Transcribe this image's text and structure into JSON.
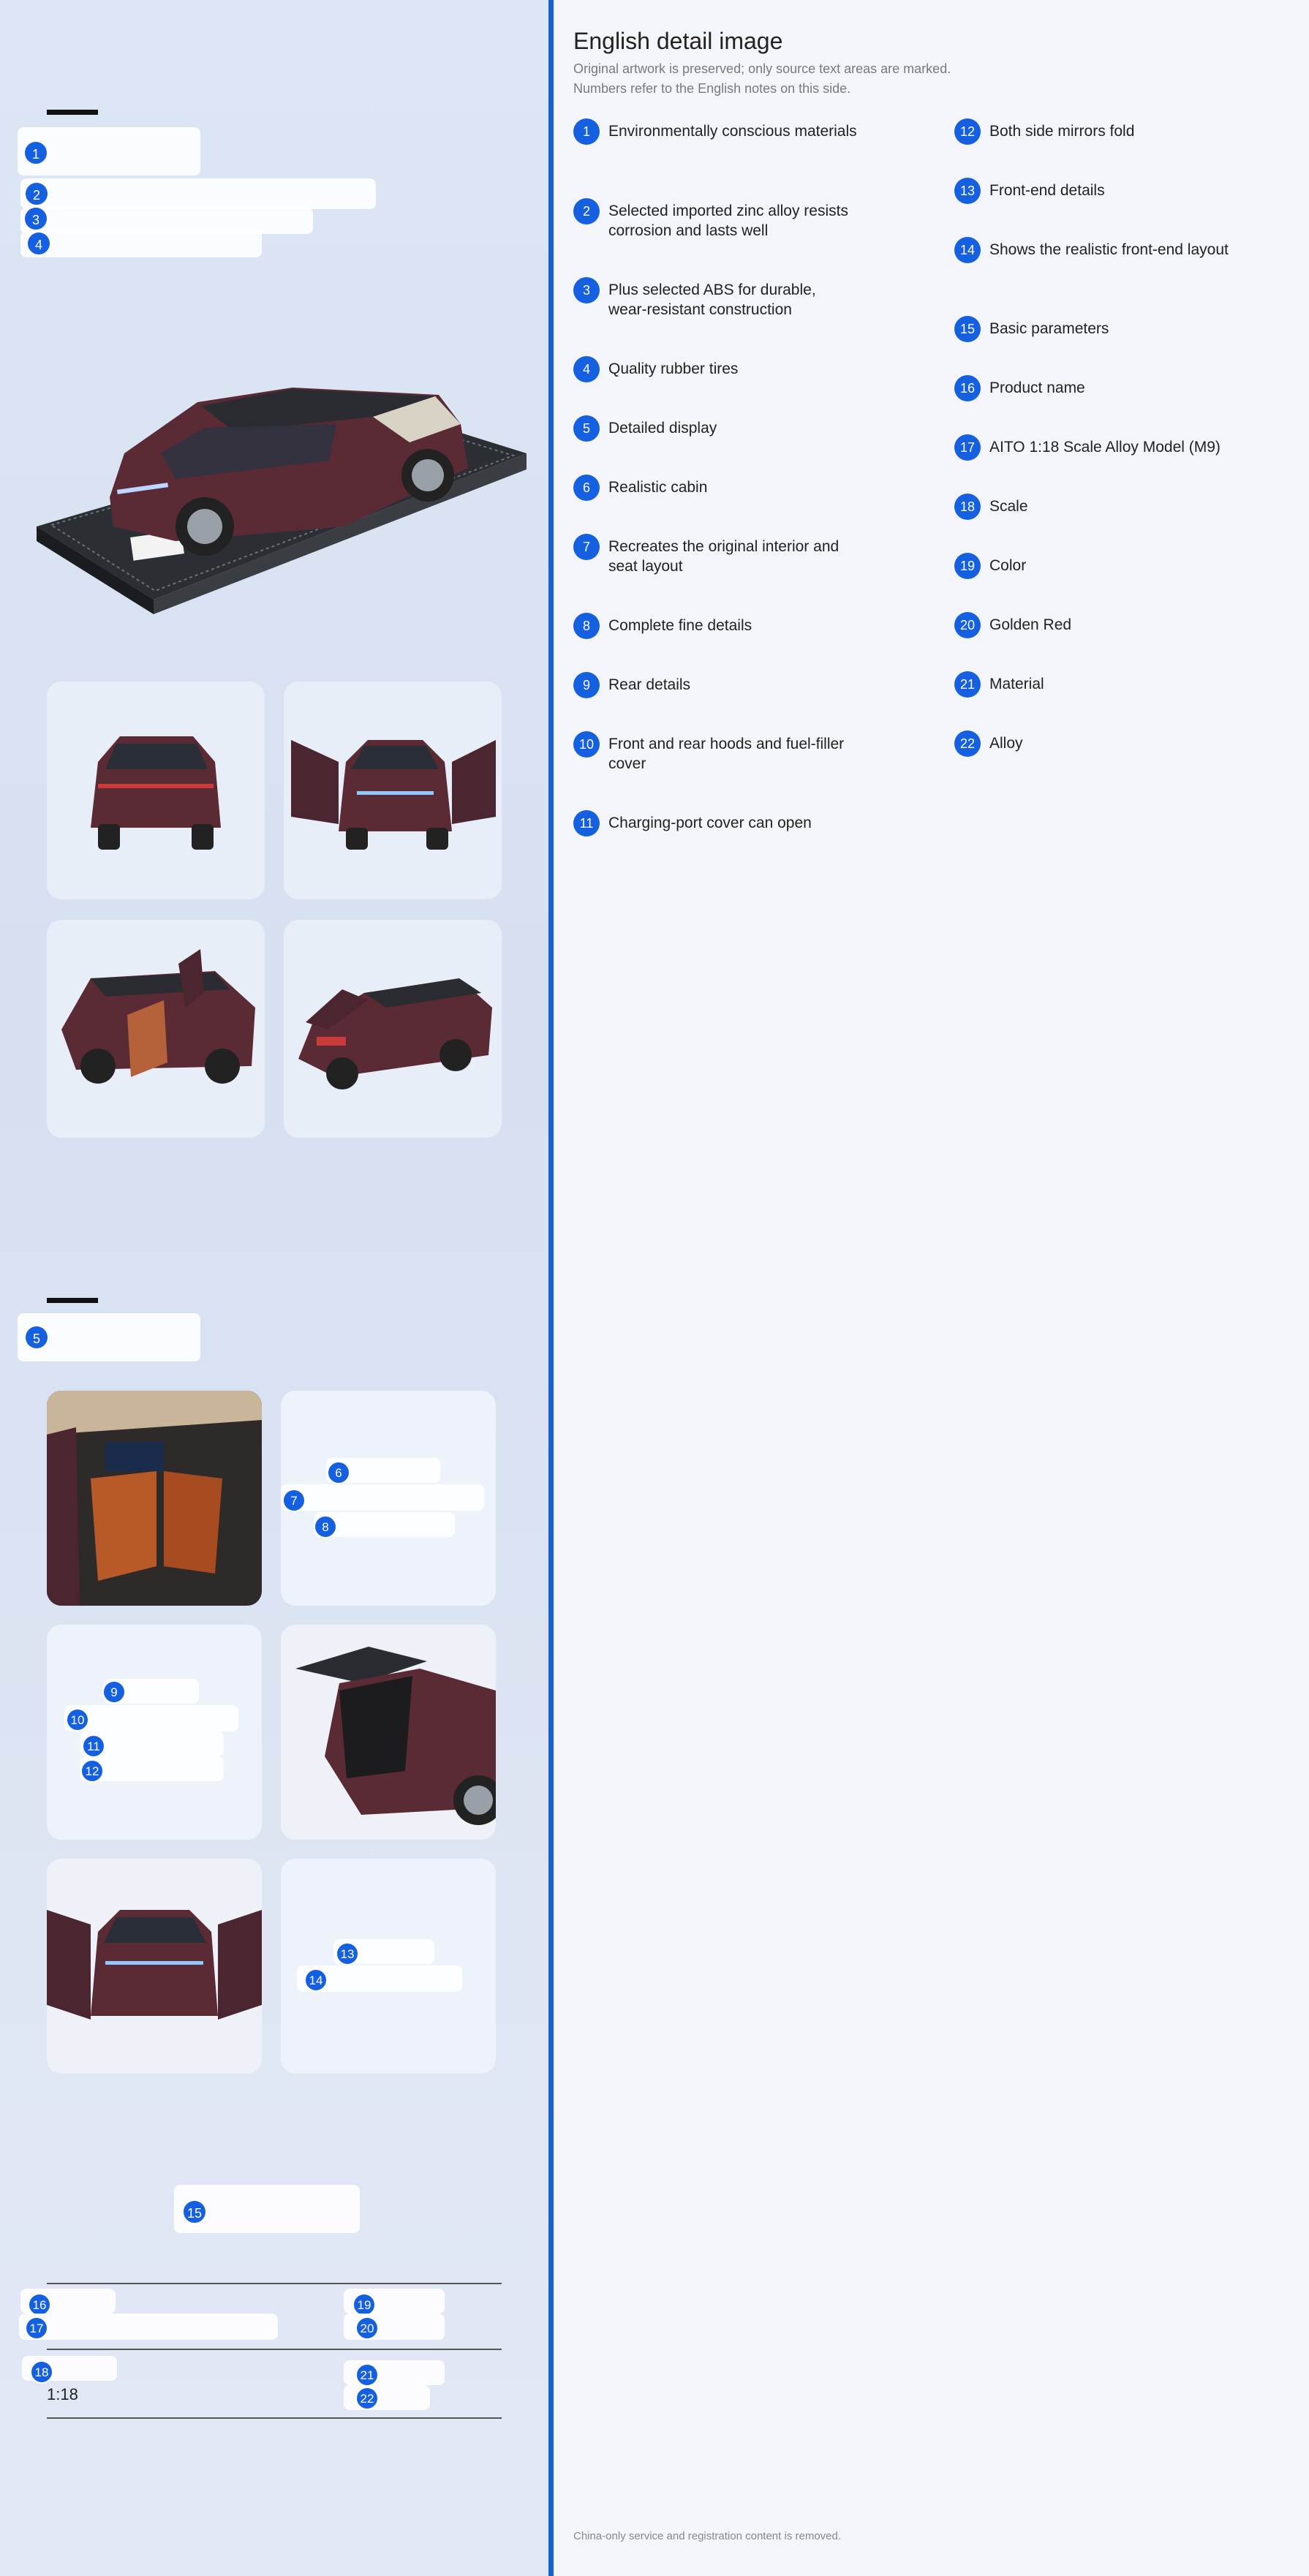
{
  "header": {
    "title": "English detail image",
    "subtitle_1": "Original artwork is preserved; only source text areas are marked.",
    "subtitle_2": "Numbers refer to the English notes on this side."
  },
  "notes": [
    {
      "n": "1",
      "text": "Environmentally conscious materials"
    },
    {
      "n": "2",
      "text": "Selected imported zinc alloy resists corrosion and lasts well"
    },
    {
      "n": "3",
      "text": "Plus selected ABS for durable, wear-resistant construction"
    },
    {
      "n": "4",
      "text": "Quality rubber tires"
    },
    {
      "n": "5",
      "text": "Detailed display"
    },
    {
      "n": "6",
      "text": "Realistic cabin"
    },
    {
      "n": "7",
      "text": "Recreates the original interior and seat layout"
    },
    {
      "n": "8",
      "text": "Complete fine details"
    },
    {
      "n": "9",
      "text": "Rear details"
    },
    {
      "n": "10",
      "text": "Front and rear hoods and fuel-filler cover"
    },
    {
      "n": "11",
      "text": "Charging-port cover can open"
    },
    {
      "n": "12",
      "text": "Both side mirrors fold"
    },
    {
      "n": "13",
      "text": "Front-end details"
    },
    {
      "n": "14",
      "text": "Shows the realistic front-end layout"
    },
    {
      "n": "15",
      "text": "Basic parameters"
    },
    {
      "n": "16",
      "text": "Product name"
    },
    {
      "n": "17",
      "text": "AITO 1:18 Scale Alloy Model (M9)"
    },
    {
      "n": "18",
      "text": "Scale"
    },
    {
      "n": "19",
      "text": "Color"
    },
    {
      "n": "20",
      "text": "Golden Red"
    },
    {
      "n": "21",
      "text": "Material"
    },
    {
      "n": "22",
      "text": "Alloy"
    }
  ],
  "artwork": {
    "scale_value": "1:18"
  },
  "footer": "China-only service and registration content is removed.",
  "colors": {
    "accent": "#1560e0",
    "divider": "#1a5fd4",
    "car_body": "#5a2a35"
  }
}
